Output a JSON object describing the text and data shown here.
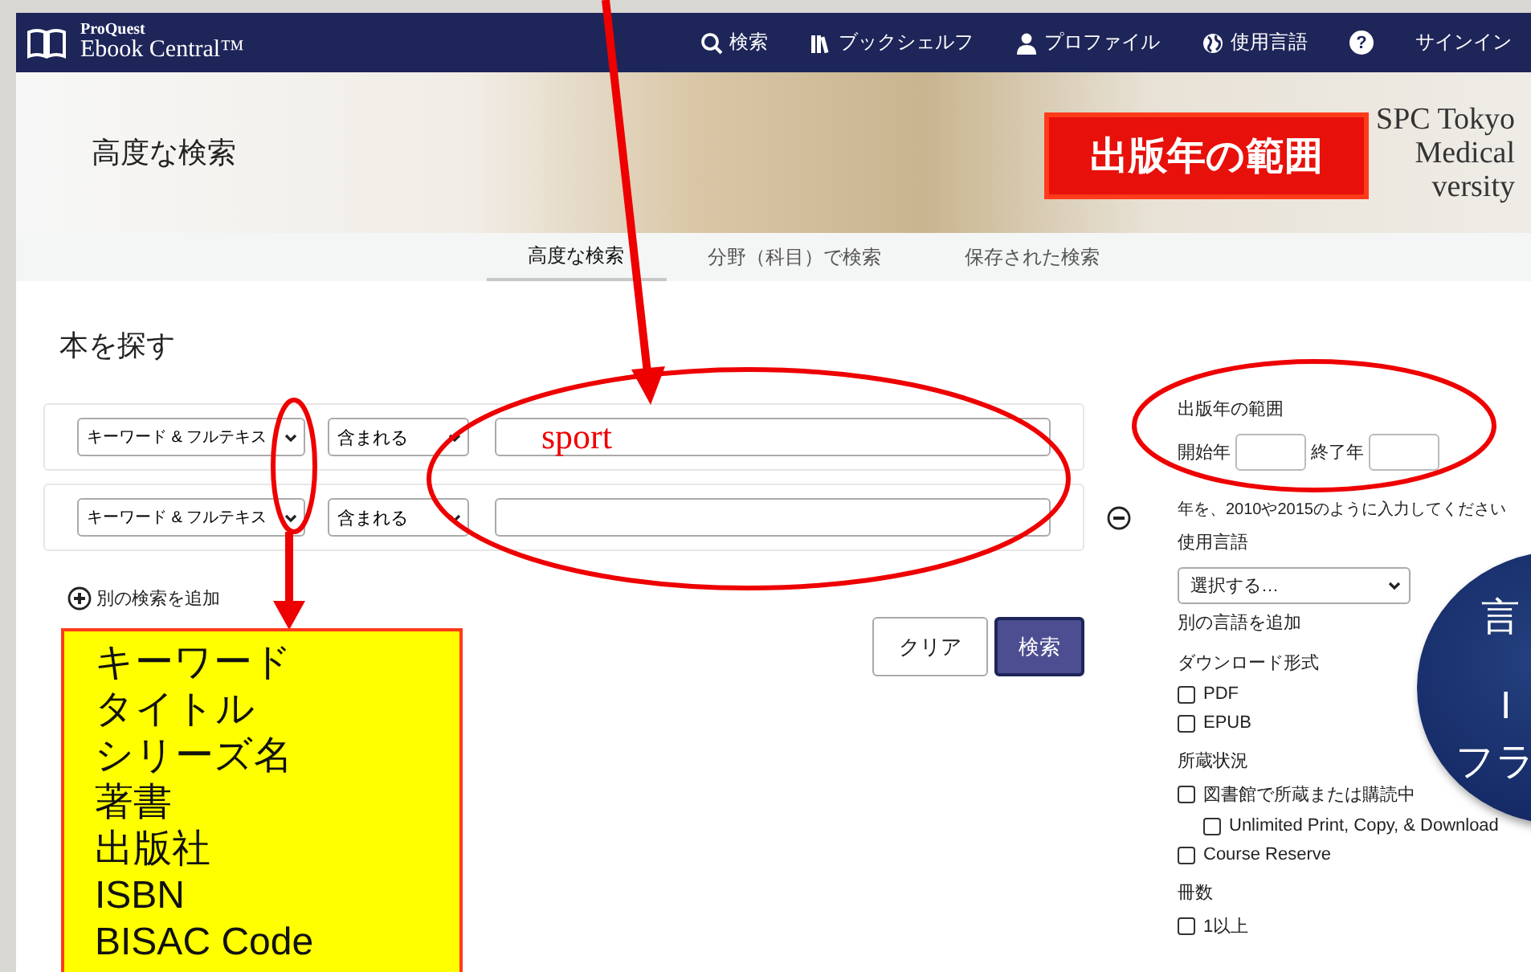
{
  "navbar": {
    "logo_top": "ProQuest",
    "logo_bottom": "Ebook Central™",
    "items": [
      {
        "kind": "search",
        "label": "検索"
      },
      {
        "kind": "books",
        "label": "ブックシェルフ"
      },
      {
        "kind": "person",
        "label": "プロファイル"
      },
      {
        "kind": "globe",
        "label": "使用言語"
      },
      {
        "kind": "help",
        "label": "?"
      },
      {
        "kind": "text",
        "label": "サインイン"
      }
    ]
  },
  "banner": {
    "title": "高度な検索",
    "institution_lines": [
      "SPC Tokyo",
      "Medical",
      "versity"
    ]
  },
  "subnav": {
    "tabs": [
      {
        "label": "高度な検索",
        "selected": true
      },
      {
        "label": "分野（科目）で検索",
        "selected": false
      },
      {
        "label": "保存された検索",
        "selected": false
      }
    ]
  },
  "search": {
    "heading": "本を探す",
    "rows": [
      {
        "field": "キーワード & フルテキス",
        "operator": "含まれる",
        "value": "sport",
        "removable": false
      },
      {
        "field": "キーワード & フルテキス",
        "operator": "含まれる",
        "removable": true
      }
    ],
    "add_label": "別の検索を追加",
    "clear": "クリア",
    "submit": "検索"
  },
  "filters": {
    "year": {
      "title": "出版年の範囲",
      "start_label": "開始年",
      "end_label": "終了年",
      "hint": "年を、2010や2015のように入力してください"
    },
    "language": {
      "title": "使用言語",
      "select": "選択する…",
      "add": "別の言語を追加"
    },
    "groups": [
      {
        "title": "ダウンロード形式",
        "options": [
          {
            "label": "PDF",
            "checked": false
          },
          {
            "label": "EPUB",
            "checked": false
          }
        ]
      },
      {
        "title": "所蔵状況",
        "options": [
          {
            "label": "図書館で所蔵または購読中",
            "checked": false,
            "children": [
              {
                "label": "Unlimited Print, Copy, & Download",
                "checked": false
              }
            ]
          },
          {
            "label": "Course Reserve",
            "checked": false
          }
        ]
      },
      {
        "title": "冊数",
        "options": [
          {
            "label": "1以上",
            "checked": false
          }
        ]
      }
    ]
  },
  "annotations": {
    "callout": "出版年の範囲",
    "field_list": [
      "キーワード",
      "タイトル",
      "シリーズ名",
      "著書",
      "出版社",
      "ISBN",
      "BISAC Code"
    ],
    "bubble_lines": [
      "言",
      "I",
      "フラ"
    ]
  }
}
